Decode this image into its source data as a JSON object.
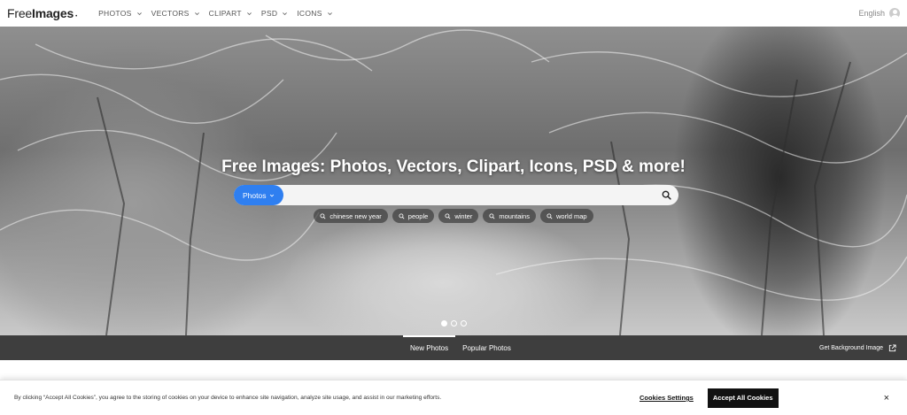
{
  "header": {
    "logo_free": "Free",
    "logo_images": "Images",
    "nav": [
      {
        "label": "PHOTOS"
      },
      {
        "label": "VECTORS"
      },
      {
        "label": "CLIPART"
      },
      {
        "label": "PSD"
      },
      {
        "label": "ICONS"
      }
    ],
    "language": "English"
  },
  "hero": {
    "title": "Free Images: Photos, Vectors, Clipart, Icons, PSD & more!",
    "search": {
      "type_label": "Photos",
      "value": "",
      "placeholder": ""
    },
    "tags": [
      "chinese new year",
      "people",
      "winter",
      "mountains",
      "world map"
    ],
    "carousel": {
      "count": 3,
      "active_index": 0
    }
  },
  "tabbar": {
    "tabs": [
      {
        "label": "New Photos",
        "active": true
      },
      {
        "label": "Popular Photos",
        "active": false
      }
    ],
    "background_link": "Get Background Image"
  },
  "cookie": {
    "text": "By clicking “Accept All Cookies”, you agree to the storing of cookies on your device to enhance site navigation, analyze site usage, and assist in our marketing efforts.",
    "settings_label": "Cookies Settings",
    "accept_label": "Accept All Cookies",
    "close_label": "×"
  },
  "colors": {
    "accent": "#2f7ff0",
    "tabbar": "#3e3e3e",
    "accept_button": "#111111"
  }
}
